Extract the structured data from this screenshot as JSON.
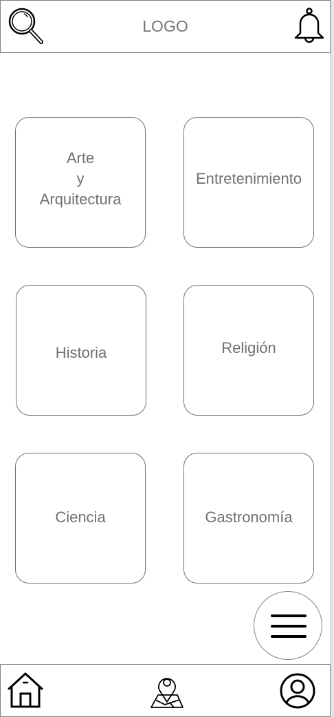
{
  "header": {
    "logo": "LOGO",
    "left_icon": "search-icon",
    "right_icon": "bell-icon"
  },
  "categories": [
    {
      "label": "Arte\ny\nArquitectura"
    },
    {
      "label": "Entretenimiento"
    },
    {
      "label": "Historia"
    },
    {
      "label": "Religión"
    },
    {
      "label": "Ciencia"
    },
    {
      "label": "Gastronomía"
    }
  ],
  "fab": {
    "icon": "hamburger-menu-icon"
  },
  "bottom_nav": {
    "items": [
      {
        "icon": "home-icon"
      },
      {
        "icon": "map-pin-icon"
      },
      {
        "icon": "user-profile-icon"
      }
    ]
  }
}
